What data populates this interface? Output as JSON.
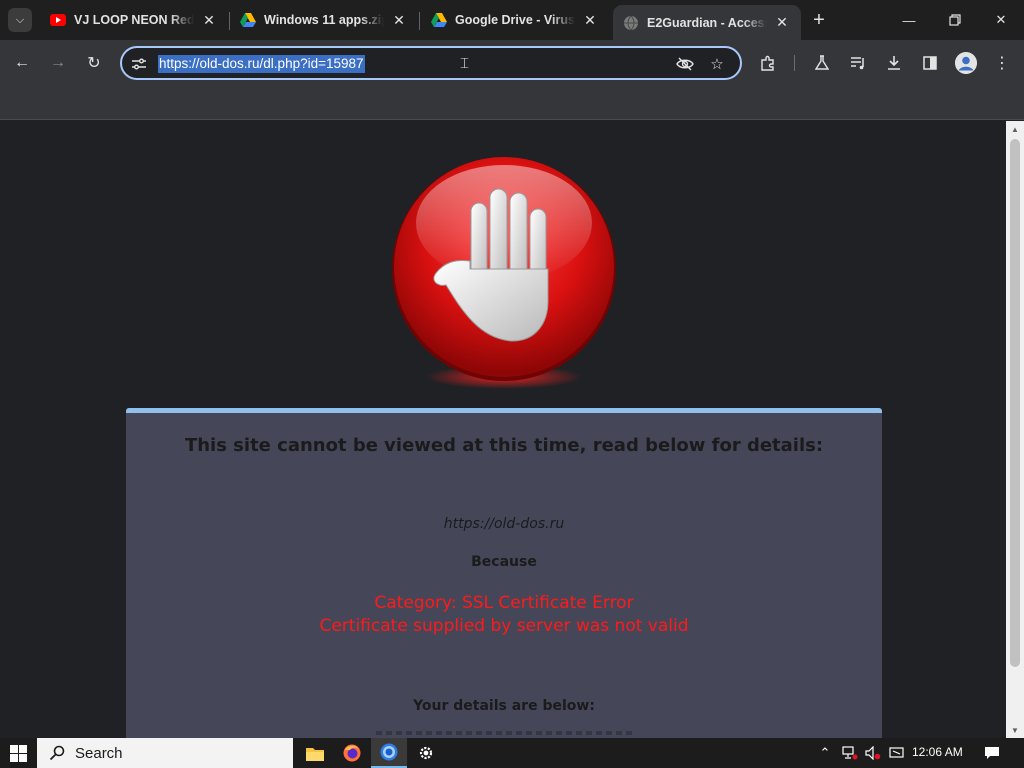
{
  "browser": {
    "tabs": [
      {
        "title": "VJ LOOP NEON Red M",
        "icon": "youtube-icon",
        "active": false
      },
      {
        "title": "Windows 11 apps.zip -",
        "icon": "google-drive-icon",
        "active": false
      },
      {
        "title": "Google Drive - Virus s",
        "icon": "google-drive-icon",
        "active": false
      },
      {
        "title": "E2Guardian - Access D",
        "icon": "globe-icon",
        "active": true
      }
    ],
    "new_tab_label": "+",
    "address": "https://old-dos.ru/dl.php?id=15987"
  },
  "page": {
    "heading": "This site cannot be viewed at this time, read below for details:",
    "blocked_url": "https://old-dos.ru",
    "because_label": "Because",
    "reason_category": "Category: SSL Certificate Error",
    "reason_detail": "Certificate supplied by server was not valid",
    "details_heading": "Your details are below:"
  },
  "taskbar": {
    "search_label": "Search",
    "time": "12:06 AM",
    "apps": [
      "file-explorer-icon",
      "firefox-icon",
      "chrome-icon",
      "settings-icon"
    ]
  },
  "colors": {
    "accent": "#a8c7fa",
    "panel_bg": "#454759",
    "panel_border": "#8fc0ee",
    "error_text": "#ff1a1a",
    "stop_red": "#e01515"
  }
}
